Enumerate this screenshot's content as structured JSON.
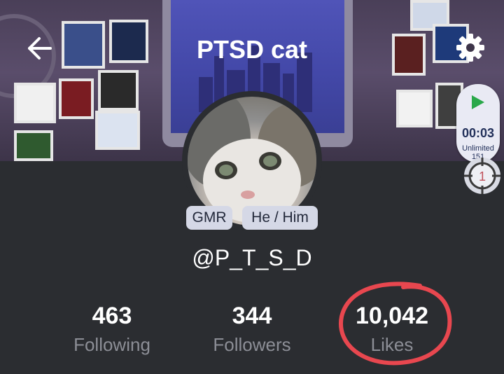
{
  "header": {
    "title": "PTSD cat",
    "back_icon": "arrow-left-icon",
    "settings_icon": "gear-icon"
  },
  "timer": {
    "icon": "play-icon",
    "time": "00:03",
    "mode": "Unlimited",
    "count": "151"
  },
  "target": {
    "icon": "crosshair-icon",
    "value": "1"
  },
  "profile": {
    "tags": [
      "GMR",
      "He / Him"
    ],
    "handle": "@P_T_S_D"
  },
  "stats": [
    {
      "value": "463",
      "label": "Following"
    },
    {
      "value": "344",
      "label": "Followers"
    },
    {
      "value": "10,042",
      "label": "Likes"
    }
  ],
  "colors": {
    "background": "#2b2d31",
    "highlight_circle": "#e8474f",
    "badge": "#d5d8e6"
  }
}
